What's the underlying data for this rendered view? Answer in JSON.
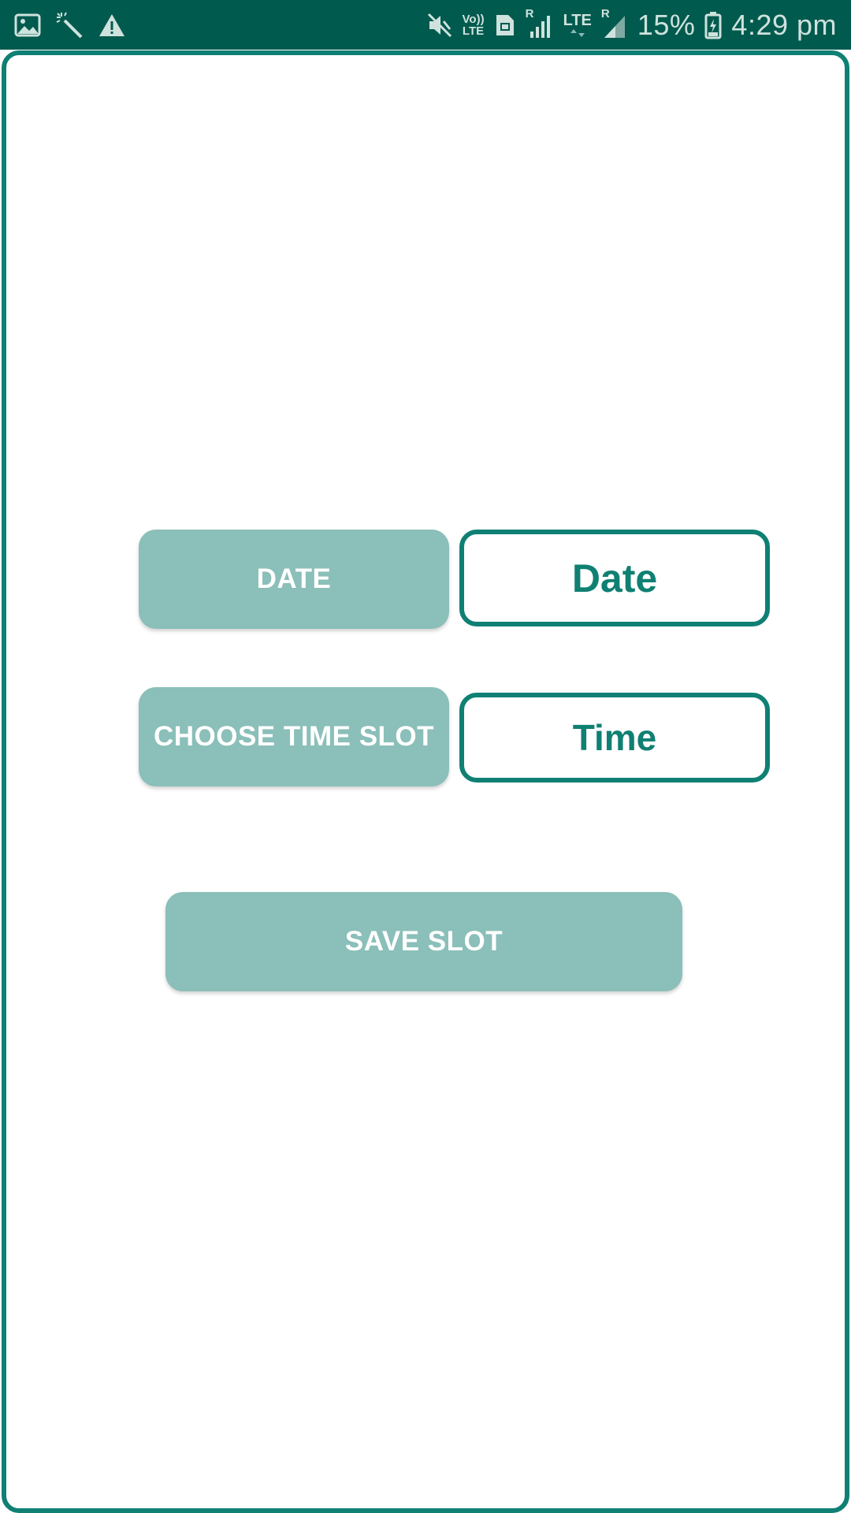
{
  "status_bar": {
    "left_icons": [
      "image-icon",
      "magic-wand-icon",
      "warning-icon"
    ],
    "right_icons": [
      "mute-icon",
      "volte-icon",
      "sim-icon",
      "signal-icon",
      "signal-2-icon",
      "battery-icon"
    ],
    "volte_line1": "Vo))",
    "volte_line2": "LTE",
    "sim1_roaming": "R",
    "lte_label": "LTE",
    "sim2_roaming": "R",
    "battery_percent": "15%",
    "time": "4:29 pm",
    "background_color": "#015a4e"
  },
  "form": {
    "date_button_label": "DATE",
    "date_value": "Date",
    "time_button_label": "CHOOSE TIME SLOT",
    "time_value": "Time",
    "save_button_label": "SAVE SLOT"
  },
  "colors": {
    "accent": "#0f8073",
    "button_fill": "#8bbfb9",
    "button_text": "#ffffff"
  }
}
